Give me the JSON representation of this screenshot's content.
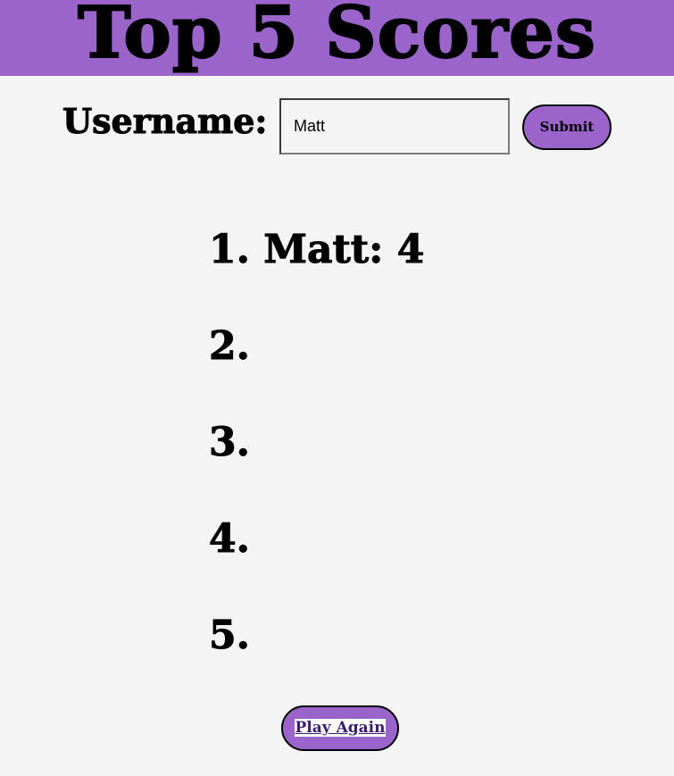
{
  "header": {
    "title": "Top 5 Scores"
  },
  "form": {
    "username_label": "Username:",
    "username_value": "Matt",
    "submit_label": "Submit"
  },
  "scores": [
    {
      "rank": "1.",
      "entry": "Matt: 4"
    },
    {
      "rank": "2.",
      "entry": ""
    },
    {
      "rank": "3.",
      "entry": ""
    },
    {
      "rank": "4.",
      "entry": ""
    },
    {
      "rank": "5.",
      "entry": ""
    }
  ],
  "footer": {
    "play_again_label": "Play Again"
  },
  "colors": {
    "header_bg": "#9b64cb",
    "page_bg": "#f4f4f4",
    "button_bg": "#9b64cb"
  }
}
